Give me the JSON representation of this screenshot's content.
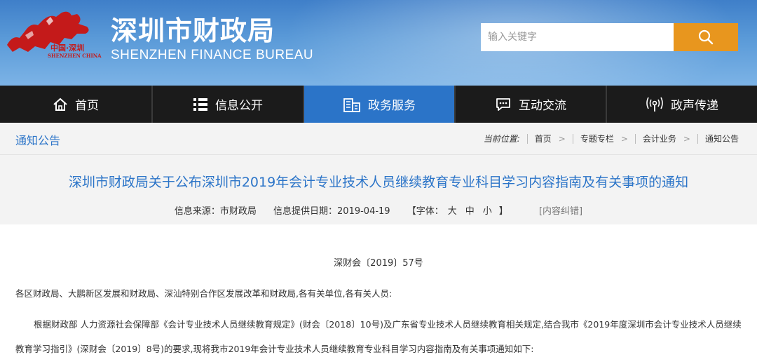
{
  "header": {
    "emblem_cn": "中国·深圳",
    "emblem_en": "SHENZHEN CHINA",
    "title": "深圳市财政局",
    "subtitle": "SHENZHEN FINANCE BUREAU",
    "search_placeholder": "输入关键字",
    "search_icon": "search-icon"
  },
  "nav": {
    "items": [
      {
        "label": "首页",
        "icon": "home-icon"
      },
      {
        "label": "信息公开",
        "icon": "list-icon"
      },
      {
        "label": "政务服务",
        "icon": "building-icon",
        "active": true
      },
      {
        "label": "互动交流",
        "icon": "chat-icon"
      },
      {
        "label": "政声传递",
        "icon": "broadcast-icon"
      }
    ]
  },
  "breadcrumb": {
    "section": "通知公告",
    "label": "当前位置:",
    "items": [
      "首页",
      "专题专栏",
      "会计业务",
      "通知公告"
    ]
  },
  "article": {
    "title": "深圳市财政局关于公布深圳市2019年会计专业技术人员继续教育专业科目学习内容指南及有关事项的通知",
    "source": "信息来源：市财政局",
    "date": "信息提供日期：2019-04-19",
    "font_label": "【字体：",
    "font_large": "大",
    "font_medium": "中",
    "font_small": "小",
    "font_close": "】",
    "correction": "[内容纠错]",
    "doc_number": "深财会〔2019〕57号",
    "salutation": "各区财政局、大鹏新区发展和财政局、深汕特别合作区发展改革和财政局,各有关单位,各有关人员:",
    "body_line1": "根据财政部 人力资源社会保障部《会计专业技术人员继续教育规定》(财会〔2018〕10号)及广东省专业技术人员继续教育相关规定,结合我市《2019年度深圳市会计专业技术人员继续",
    "body_line2": "教育学习指引》(深财会〔2019〕8号)的要求,现将我市2019年会计专业技术人员继续教育专业科目学习内容指南及有关事项通知如下:"
  },
  "colors": {
    "header_blue": "#3f7fc9",
    "nav_bg": "#1b1b1b",
    "nav_active": "#2b74c8",
    "search_button": "#e8961e",
    "title_blue": "#2b74c8",
    "emblem_red": "#c41a1a"
  }
}
